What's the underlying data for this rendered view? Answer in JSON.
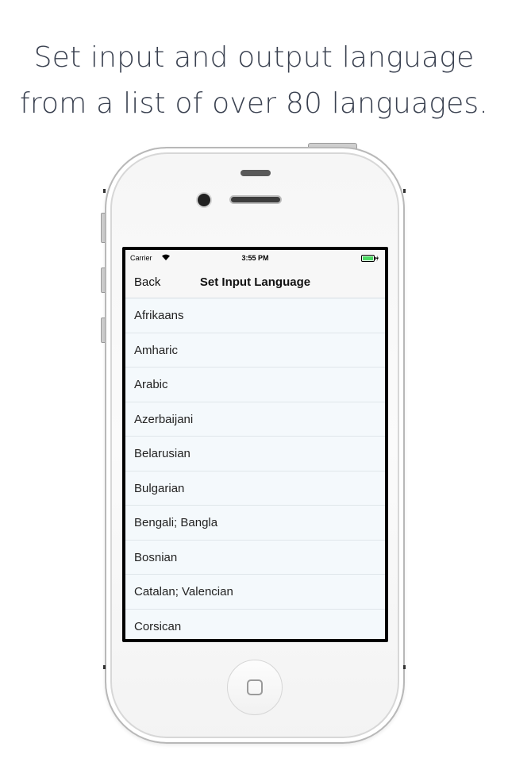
{
  "promo": {
    "line1": "Set input and output language",
    "line2": "from a list of over 80 languages."
  },
  "status_bar": {
    "carrier": "Carrier",
    "time": "3:55 PM",
    "wifi_icon": "wifi-icon",
    "battery_icon": "battery-charging-icon",
    "battery_color": "#4cd964"
  },
  "nav": {
    "back_label": "Back",
    "title": "Set Input Language"
  },
  "languages": [
    "Afrikaans",
    "Amharic",
    "Arabic",
    "Azerbaijani",
    "Belarusian",
    "Bulgarian",
    "Bengali; Bangla",
    "Bosnian",
    "Catalan; Valencian",
    "Corsican"
  ],
  "device": {
    "home_icon": "home-button-icon"
  }
}
